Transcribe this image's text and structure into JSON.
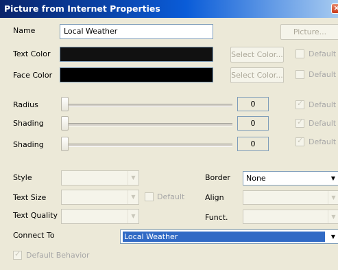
{
  "window": {
    "title": "Picture from Internet Properties",
    "close_glyph": "×"
  },
  "name": {
    "label": "Name",
    "value": "Local Weather",
    "picture_button": "Picture..."
  },
  "text_color": {
    "label": "Text Color",
    "select_button": "Select Color...",
    "default_label": "Default"
  },
  "face_color": {
    "label": "Face Color",
    "select_button": "Select Color...",
    "default_label": "Default"
  },
  "sliders": [
    {
      "label": "Radius",
      "value": "0",
      "default_label": "Default",
      "default_checked": true
    },
    {
      "label": "Shading",
      "value": "0",
      "default_label": "Default",
      "default_checked": true
    },
    {
      "label": "Shading",
      "value": "0",
      "default_label": "Default",
      "default_checked": true
    }
  ],
  "left_fields": {
    "style_label": "Style",
    "text_size_label": "Text Size",
    "text_size_default_label": "Default",
    "text_quality_label": "Text Quality",
    "connect_to_label": "Connect To",
    "connect_to_value": "Local Weather"
  },
  "right_fields": {
    "border_label": "Border",
    "border_value": "None",
    "align_label": "Align",
    "funct_label": "Funct."
  },
  "default_behavior": {
    "label": "Default Behavior",
    "checked": true
  },
  "colors": {
    "text_color": "#111111",
    "face_color": "#000000",
    "selection": "#316AC5"
  }
}
